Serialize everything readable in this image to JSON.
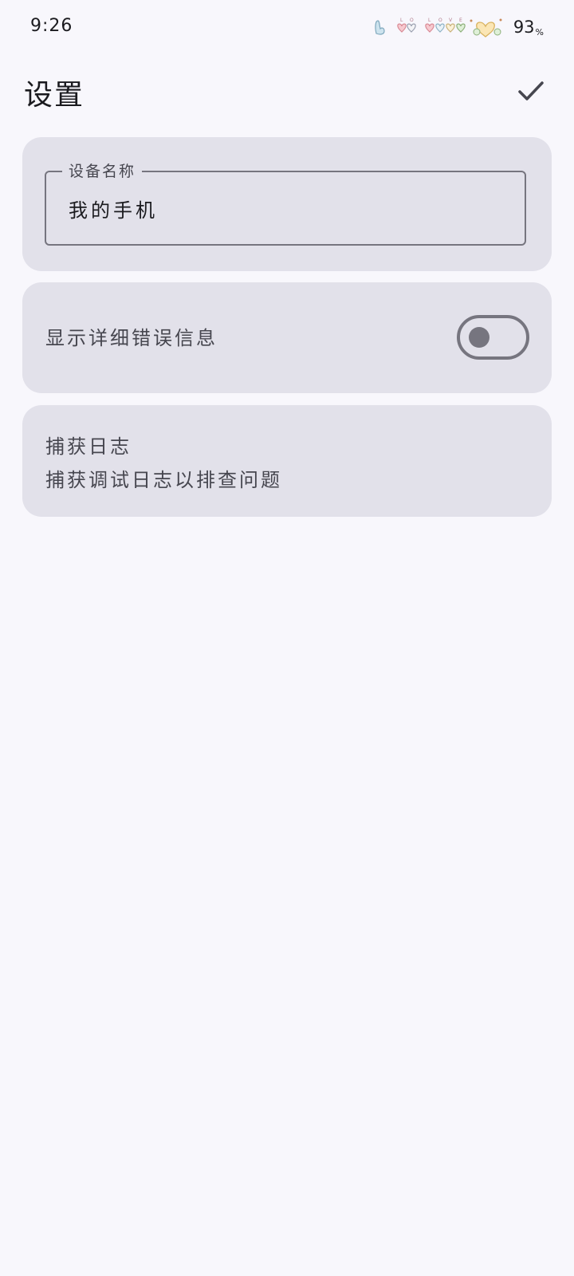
{
  "status_bar": {
    "time": "9:26",
    "battery_value": "93",
    "battery_unit": "%",
    "decoration_icon": "love-hearts-icon"
  },
  "app_bar": {
    "title": "设置",
    "confirm_icon": "check-icon"
  },
  "device_name": {
    "label": "设备名称",
    "value": "我的手机"
  },
  "error_details": {
    "label": "显示详细错误信息",
    "enabled": false
  },
  "capture_logs": {
    "title": "捕获日志",
    "subtitle": "捕获调试日志以排查问题"
  },
  "colors": {
    "background": "#f8f7fc",
    "card": "#e2e1ea",
    "outline": "#76757f",
    "text_primary": "#1b1b1f",
    "text_secondary": "#46464f"
  }
}
